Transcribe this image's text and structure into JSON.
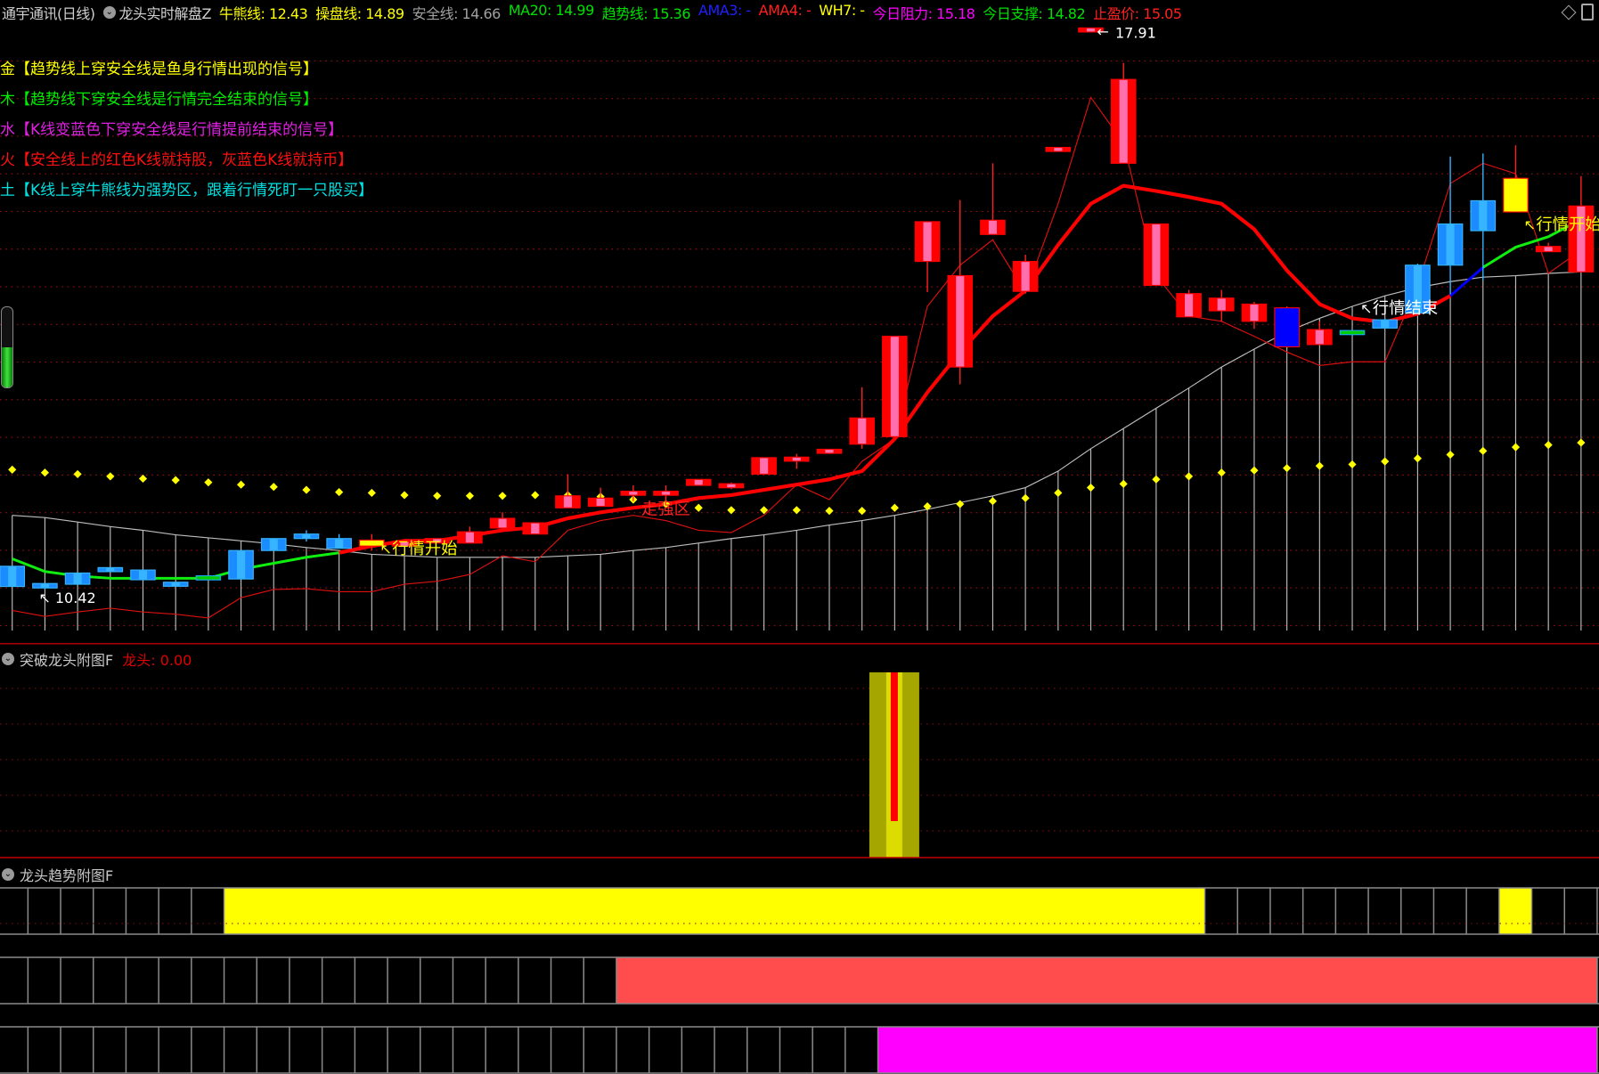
{
  "header": {
    "title": "通宇通讯(日线)",
    "indicator": "龙头实时解盘Z",
    "items": [
      {
        "text": "牛熊线: 12.43",
        "color": "#ffff00"
      },
      {
        "text": "操盘线: 14.89",
        "color": "#ffff00"
      },
      {
        "text": "安全线: 14.66",
        "color": "#a0a0a0"
      },
      {
        "text": "MA20: 14.99",
        "color": "#00e000"
      },
      {
        "text": "趋势线: 15.36",
        "color": "#00e000"
      },
      {
        "text": "AMA3: -",
        "color": "#2020ff"
      },
      {
        "text": "AMA4: -",
        "color": "#ff2020"
      },
      {
        "text": "WH7: -",
        "color": "#ffff00"
      },
      {
        "text": "今日阻力: 15.18",
        "color": "#ff00ff"
      },
      {
        "text": "今日支撑: 14.82",
        "color": "#00e000"
      },
      {
        "text": "止盈价: 15.05",
        "color": "#ff2020"
      }
    ]
  },
  "legend": [
    {
      "text": "金【趋势线上穿安全线是鱼身行情出现的信号】",
      "color": "#ffff00"
    },
    {
      "text": "木【趋势线下穿安全线是行情完全结束的信号】",
      "color": "#00ee00"
    },
    {
      "text": "水【K线变蓝色下穿安全线是行情提前结束的信号】",
      "color": "#e020e0"
    },
    {
      "text": "火【安全线上的红色K线就持股，灰蓝色K线就持币】",
      "color": "#ff1010"
    },
    {
      "text": "土【K线上穿牛熊线为强势区，跟着行情死盯一只股买】",
      "color": "#00e0e0"
    }
  ],
  "chart_data": {
    "type": "candlestick",
    "ylim": [
      10.05,
      18.0
    ],
    "max_label": "17.91",
    "min_label": "10.42",
    "candles": [
      {
        "o": 10.73,
        "h": 10.73,
        "l": 10.46,
        "c": 10.46,
        "col": "b"
      },
      {
        "o": 10.5,
        "h": 10.5,
        "l": 10.42,
        "c": 10.44,
        "col": "b"
      },
      {
        "o": 10.64,
        "h": 10.64,
        "l": 10.48,
        "c": 10.49,
        "col": "b"
      },
      {
        "o": 10.71,
        "h": 10.71,
        "l": 10.65,
        "c": 10.66,
        "col": "b"
      },
      {
        "o": 10.68,
        "h": 10.68,
        "l": 10.54,
        "c": 10.55,
        "col": "b"
      },
      {
        "o": 10.51,
        "h": 10.51,
        "l": 10.47,
        "c": 10.47,
        "col": "b"
      },
      {
        "o": 10.58,
        "h": 10.58,
        "l": 10.57,
        "c": 10.57,
        "col": "g"
      },
      {
        "o": 10.94,
        "h": 10.94,
        "l": 10.56,
        "c": 10.56,
        "col": "b"
      },
      {
        "o": 11.1,
        "h": 11.1,
        "l": 10.94,
        "c": 10.94,
        "col": "b"
      },
      {
        "o": 11.16,
        "h": 11.21,
        "l": 11.06,
        "c": 11.1,
        "col": "b"
      },
      {
        "o": 11.1,
        "h": 11.16,
        "l": 10.97,
        "c": 10.97,
        "col": "b"
      },
      {
        "o": 11.0,
        "h": 11.16,
        "l": 10.94,
        "c": 11.08,
        "col": "y"
      },
      {
        "o": 11.0,
        "h": 11.06,
        "l": 11.0,
        "c": 11.06,
        "col": "r"
      },
      {
        "o": 11.04,
        "h": 11.1,
        "l": 11.04,
        "c": 11.1,
        "col": "r"
      },
      {
        "o": 11.04,
        "h": 11.26,
        "l": 11.04,
        "c": 11.19,
        "col": "r"
      },
      {
        "o": 11.24,
        "h": 11.45,
        "l": 11.24,
        "c": 11.37,
        "col": "r"
      },
      {
        "o": 11.16,
        "h": 11.31,
        "l": 11.16,
        "c": 11.31,
        "col": "r"
      },
      {
        "o": 11.51,
        "h": 11.96,
        "l": 11.51,
        "c": 11.67,
        "col": "r"
      },
      {
        "o": 11.53,
        "h": 11.78,
        "l": 11.53,
        "c": 11.64,
        "col": "r"
      },
      {
        "o": 11.69,
        "h": 11.81,
        "l": 11.6,
        "c": 11.72,
        "col": "r"
      },
      {
        "o": 11.69,
        "h": 11.81,
        "l": 11.59,
        "c": 11.72,
        "col": "r"
      },
      {
        "o": 11.81,
        "h": 11.89,
        "l": 11.81,
        "c": 11.89,
        "col": "r"
      },
      {
        "o": 11.8,
        "h": 11.85,
        "l": 11.76,
        "c": 11.81,
        "col": "r"
      },
      {
        "o": 11.96,
        "h": 12.18,
        "l": 11.96,
        "c": 12.18,
        "col": "r"
      },
      {
        "o": 12.14,
        "h": 12.23,
        "l": 12.03,
        "c": 12.18,
        "col": "r"
      },
      {
        "o": 12.25,
        "h": 12.28,
        "l": 12.23,
        "c": 12.28,
        "col": "r"
      },
      {
        "o": 12.36,
        "h": 13.12,
        "l": 12.3,
        "c": 12.71,
        "col": "r"
      },
      {
        "o": 12.46,
        "h": 13.8,
        "l": 12.46,
        "c": 13.8,
        "col": "r"
      },
      {
        "o": 14.8,
        "h": 15.33,
        "l": 14.39,
        "c": 15.33,
        "col": "r"
      },
      {
        "o": 13.39,
        "h": 15.62,
        "l": 13.16,
        "c": 14.61,
        "col": "r"
      },
      {
        "o": 15.16,
        "h": 16.11,
        "l": 15.16,
        "c": 15.35,
        "col": "r"
      },
      {
        "o": 14.4,
        "h": 14.89,
        "l": 14.37,
        "c": 14.8,
        "col": "r"
      },
      {
        "o": 16.29,
        "h": 16.3,
        "l": 16.29,
        "c": 16.3,
        "col": "r"
      },
      {
        "o": 17.88,
        "h": 17.91,
        "l": 17.88,
        "c": 17.9,
        "col": "r"
      },
      {
        "o": 16.11,
        "h": 17.45,
        "l": 16.11,
        "c": 17.23,
        "col": "r"
      },
      {
        "o": 14.48,
        "h": 15.3,
        "l": 14.48,
        "c": 15.3,
        "col": "r"
      },
      {
        "o": 14.06,
        "h": 14.42,
        "l": 14.06,
        "c": 14.37,
        "col": "r"
      },
      {
        "o": 14.14,
        "h": 14.42,
        "l": 14.0,
        "c": 14.31,
        "col": "r"
      },
      {
        "o": 14.0,
        "h": 14.26,
        "l": 13.9,
        "c": 14.23,
        "col": "r"
      },
      {
        "o": 14.18,
        "h": 14.2,
        "l": 13.66,
        "c": 13.66,
        "col": "db"
      },
      {
        "o": 13.69,
        "h": 14.0,
        "l": 13.69,
        "c": 13.89,
        "col": "r"
      },
      {
        "o": 13.84,
        "h": 13.86,
        "l": 13.8,
        "c": 13.86,
        "col": "g"
      },
      {
        "o": 14.02,
        "h": 14.04,
        "l": 13.91,
        "c": 13.91,
        "col": "b"
      },
      {
        "o": 14.75,
        "h": 14.77,
        "l": 14.11,
        "c": 14.11,
        "col": "b"
      },
      {
        "o": 15.3,
        "h": 16.2,
        "l": 14.36,
        "c": 14.75,
        "col": "b"
      },
      {
        "o": 15.61,
        "h": 16.24,
        "l": 14.55,
        "c": 15.21,
        "col": "b"
      },
      {
        "o": 15.46,
        "h": 16.35,
        "l": 15.46,
        "c": 15.91,
        "col": "y"
      },
      {
        "o": 14.93,
        "h": 15.05,
        "l": 14.93,
        "c": 15.0,
        "col": "r"
      },
      {
        "o": 14.66,
        "h": 15.94,
        "l": 14.66,
        "c": 15.54,
        "col": "r"
      }
    ],
    "trend_line": [
      10.83,
      10.66,
      10.6,
      10.57,
      10.57,
      10.57,
      10.57,
      10.69,
      10.77,
      10.85,
      10.91,
      11.0,
      11.07,
      11.07,
      11.14,
      11.21,
      11.25,
      11.37,
      11.45,
      11.51,
      11.56,
      11.64,
      11.68,
      11.75,
      11.82,
      11.89,
      12.0,
      12.43,
      13.05,
      13.59,
      14.07,
      14.41,
      15.02,
      15.57,
      15.81,
      15.74,
      15.66,
      15.57,
      15.23,
      14.68,
      14.23,
      14.04,
      13.99,
      14.1,
      14.34,
      14.72,
      14.99,
      15.13,
      15.36
    ],
    "trend_segment_colors": {
      "green": [
        [
          0,
          9
        ],
        [
          45,
          47
        ]
      ],
      "red": [
        [
          10,
          43
        ]
      ],
      "blue": [
        [
          44,
          44
        ]
      ]
    },
    "thin_line": [
      10.14,
      10.06,
      10.12,
      10.17,
      10.12,
      10.09,
      10.04,
      10.31,
      10.42,
      10.43,
      10.39,
      10.39,
      10.49,
      10.53,
      10.62,
      10.87,
      10.79,
      11.21,
      11.34,
      11.41,
      11.34,
      11.21,
      11.18,
      11.41,
      11.82,
      11.62,
      12.13,
      12.43,
      14.2,
      14.75,
      15.09,
      14.38,
      15.57,
      16.99,
      16.38,
      14.61,
      14.07,
      14.0,
      13.8,
      13.59,
      13.41,
      13.46,
      13.46,
      14.48,
      15.84,
      16.11,
      15.97,
      14.64,
      14.95
    ],
    "safety_line": [
      11.41,
      11.38,
      11.32,
      11.26,
      11.21,
      11.15,
      11.11,
      11.07,
      11.03,
      10.98,
      10.94,
      10.89,
      10.87,
      10.85,
      10.85,
      10.85,
      10.85,
      10.87,
      10.89,
      10.94,
      10.98,
      11.04,
      11.1,
      11.15,
      11.21,
      11.28,
      11.34,
      11.41,
      11.49,
      11.58,
      11.67,
      11.78,
      12.0,
      12.3,
      12.57,
      12.84,
      13.11,
      13.39,
      13.63,
      13.86,
      14.04,
      14.2,
      14.34,
      14.45,
      14.53,
      14.59,
      14.61,
      14.64,
      14.66
    ],
    "bull_bear_dots": [
      12.02,
      11.98,
      11.96,
      11.93,
      11.9,
      11.88,
      11.85,
      11.82,
      11.79,
      11.75,
      11.72,
      11.71,
      11.68,
      11.67,
      11.67,
      11.67,
      11.68,
      11.68,
      11.66,
      11.62,
      11.56,
      11.51,
      11.48,
      11.48,
      11.48,
      11.47,
      11.47,
      11.51,
      11.53,
      11.56,
      11.6,
      11.64,
      11.71,
      11.78,
      11.83,
      11.89,
      11.93,
      11.98,
      12.01,
      12.04,
      12.07,
      12.09,
      12.13,
      12.17,
      12.22,
      12.27,
      12.32,
      12.35,
      12.38
    ],
    "annotations": [
      {
        "text": "行情开始",
        "bar": 11,
        "price": 10.99,
        "color": "#ffff00",
        "arrow": "↖"
      },
      {
        "text": "走强区",
        "bar": 19,
        "price": 11.52,
        "color": "#ff2020",
        "arrow": ""
      },
      {
        "text": "行情结束",
        "bar": 41,
        "price": 14.2,
        "color": "#ffffff",
        "arrow": "↖"
      },
      {
        "text": "行情开始",
        "bar": 46,
        "price": 15.32,
        "color": "#ffff00",
        "arrow": "↖"
      }
    ]
  },
  "meter": {
    "level": 0.5
  },
  "sub1": {
    "title": "突破龙头附图F",
    "value_label": "龙头: 0.00",
    "signal_bar": 27
  },
  "sub2": {
    "title": "龙头趋势附图F",
    "strips": [
      {
        "color": "#ffff00",
        "ranges": [
          [
            7,
            36
          ],
          [
            46,
            46
          ]
        ]
      },
      {
        "color": "#ff4c4c",
        "ranges": [
          [
            19,
            48
          ]
        ]
      },
      {
        "color": "#ff00ff",
        "ranges": [
          [
            27,
            48
          ]
        ]
      }
    ]
  }
}
